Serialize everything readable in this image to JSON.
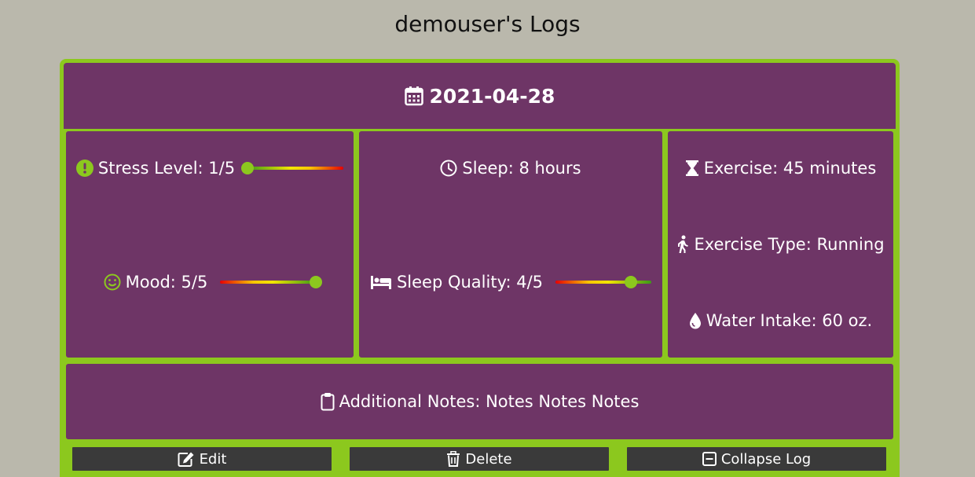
{
  "page": {
    "title": "demouser's Logs"
  },
  "log": {
    "date": "2021-04-28",
    "stress_label": "Stress Level: 1/5",
    "stress_value": 1,
    "mood_label": "Mood: 5/5",
    "mood_value": 5,
    "sleep_label": "Sleep: 8 hours",
    "sleep_quality_label": "Sleep Quality: 4/5",
    "sleep_quality_value": 4,
    "exercise_label": "Exercise: 45 minutes",
    "exercise_type_label": "Exercise Type: Running",
    "water_label": "Water Intake: 60 oz.",
    "notes_label": "Additional Notes: Notes Notes Notes"
  },
  "buttons": {
    "edit": "Edit",
    "delete": "Delete",
    "collapse": "Collapse Log"
  },
  "colors": {
    "background": "#bab8ac",
    "card": "#6e3566",
    "accent": "#8cc81e",
    "button": "#3a3a3a"
  },
  "icons": {
    "date": "calendar-icon",
    "stress": "exclamation-circle-icon",
    "mood": "smile-icon",
    "sleep": "clock-icon",
    "sleep_quality": "bed-icon",
    "exercise": "hourglass-icon",
    "exercise_type": "walking-icon",
    "water": "droplet-icon",
    "notes": "clipboard-icon",
    "edit": "edit-icon",
    "delete": "trash-icon",
    "collapse": "minus-square-icon"
  }
}
